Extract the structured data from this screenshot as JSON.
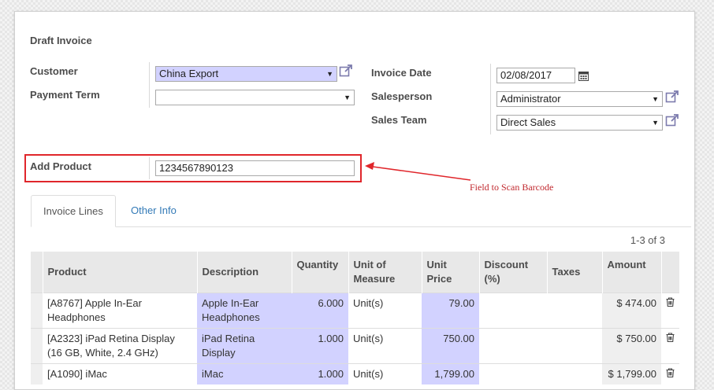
{
  "form": {
    "title": "Draft Invoice",
    "customer": {
      "label": "Customer",
      "value": "China Export"
    },
    "payment_term": {
      "label": "Payment Term",
      "value": ""
    },
    "invoice_date": {
      "label": "Invoice Date",
      "value": "02/08/2017"
    },
    "salesperson": {
      "label": "Salesperson",
      "value": "Administrator"
    },
    "sales_team": {
      "label": "Sales Team",
      "value": "Direct Sales"
    },
    "add_product": {
      "label": "Add Product",
      "value": "1234567890123"
    }
  },
  "annotation": {
    "text": "Field to Scan Barcode",
    "color": "#c0272d"
  },
  "tabs": [
    {
      "label": "Invoice Lines",
      "active": true
    },
    {
      "label": "Other Info",
      "active": false
    }
  ],
  "pager": "1-3 of 3",
  "table": {
    "headers": {
      "product": "Product",
      "description": "Description",
      "quantity": "Quantity",
      "unit": "Unit of Measure",
      "unit_price": "Unit Price",
      "discount": "Discount (%)",
      "taxes": "Taxes",
      "amount": "Amount"
    },
    "rows": [
      {
        "product": "[A8767] Apple In-Ear Headphones",
        "description": "Apple In-Ear Headphones",
        "quantity": "6.000",
        "unit": "Unit(s)",
        "unit_price": "79.00",
        "discount": "",
        "taxes": "",
        "amount": "$ 474.00"
      },
      {
        "product": "[A2323] iPad Retina Display (16 GB, White, 2.4 GHz)",
        "description": "iPad Retina Display",
        "quantity": "1.000",
        "unit": "Unit(s)",
        "unit_price": "750.00",
        "discount": "",
        "taxes": "",
        "amount": "$ 750.00"
      },
      {
        "product": "[A1090] iMac",
        "description": "iMac",
        "quantity": "1.000",
        "unit": "Unit(s)",
        "unit_price": "1,799.00",
        "discount": "",
        "taxes": "",
        "amount": "$ 1,799.00"
      }
    ]
  },
  "colors": {
    "required_field": "#d2d2ff",
    "highlight": "#e0262b",
    "link": "#337ab7"
  }
}
